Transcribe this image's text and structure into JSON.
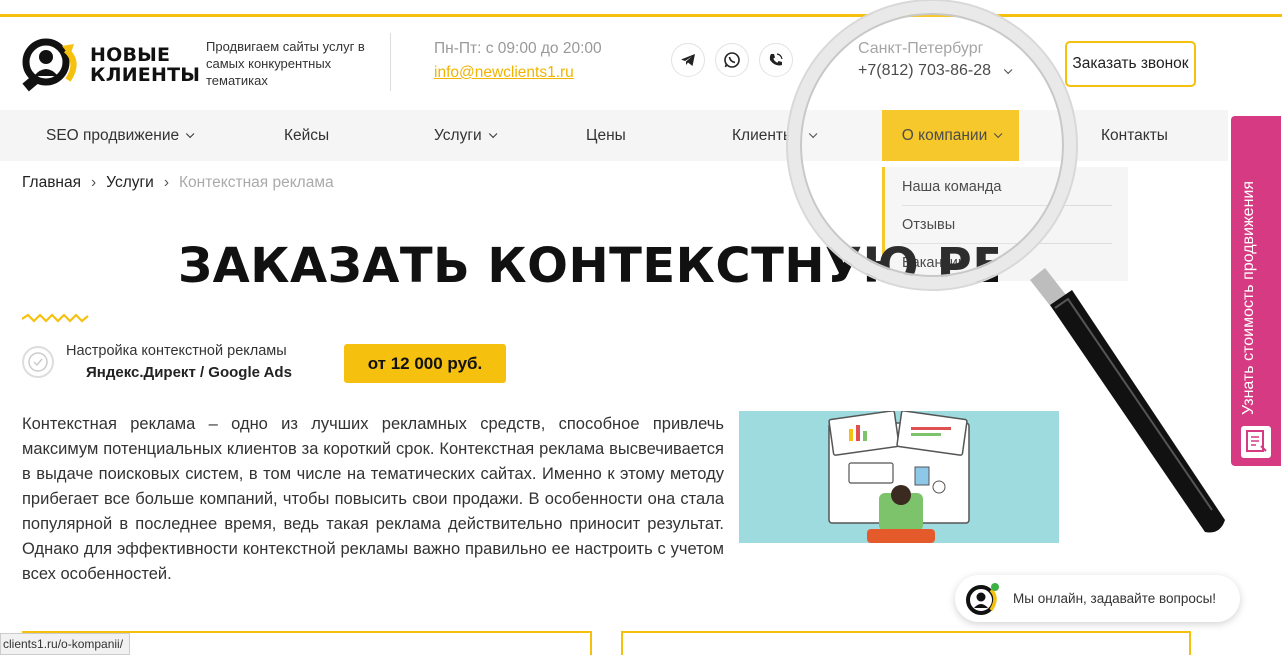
{
  "header": {
    "logo_line1": "НОВЫЕ",
    "logo_line2": "КЛИЕНТЫ",
    "tagline": "Продвигаем сайты услуг в самых конкурентных тематиках",
    "hours": "Пн-Пт: с 09:00 до 20:00",
    "email": "info@newclients1.ru",
    "city": "Санкт-Петербург",
    "phone": "+7(812) 703-86-28",
    "call_button": "Заказать звонок",
    "social_icons": [
      "telegram-icon",
      "whatsapp-icon",
      "viber-icon"
    ]
  },
  "nav": {
    "items": [
      {
        "label": "SEO продвижение",
        "has_dropdown": true
      },
      {
        "label": "Кейсы",
        "has_dropdown": false
      },
      {
        "label": "Услуги",
        "has_dropdown": true
      },
      {
        "label": "Цены",
        "has_dropdown": false
      },
      {
        "label": "Клиенты",
        "has_dropdown": true
      },
      {
        "label": "О компании",
        "has_dropdown": true,
        "active": true
      },
      {
        "label": "Контакты",
        "has_dropdown": false
      }
    ],
    "dropdown": [
      "Наша команда",
      "Отзывы",
      "Вакансии"
    ]
  },
  "breadcrumb": {
    "items": [
      "Главная",
      "Услуги",
      "Контекстная реклама"
    ]
  },
  "page": {
    "title": "ЗАКАЗАТЬ КОНТЕКСТНУЮ РЕКЛАМУ",
    "service_line1": "Настройка контекстной рекламы",
    "service_line2": "Яндекс.Директ / Google Ads",
    "price": "от 12 000 руб.",
    "paragraph": "Контекстная реклама – одно из лучших рекламных средств, способное привлечь максимум потенциальных клиентов за короткий срок. Контекстная реклама высвечивается в выдаче поисковых систем, в том числе на тематических сайтах. Именно к этому методу прибегает все больше компаний, чтобы повысить свои продажи. В особенности она стала популярной в последнее время, ведь такая реклама действительно приносит результат. Однако для эффективности контекстной рекламы важно правильно ее настроить с учетом всех особенностей."
  },
  "side_tab": {
    "label": "Узнать стоимость продвижения"
  },
  "chat": {
    "label": "Мы онлайн, задавайте вопросы!"
  },
  "status_bar": {
    "url": "clients1.ru/o-kompanii/"
  },
  "colors": {
    "accent": "#f5c10e",
    "side_tab": "#d63a83",
    "illustration_bg": "#9edbdf"
  }
}
